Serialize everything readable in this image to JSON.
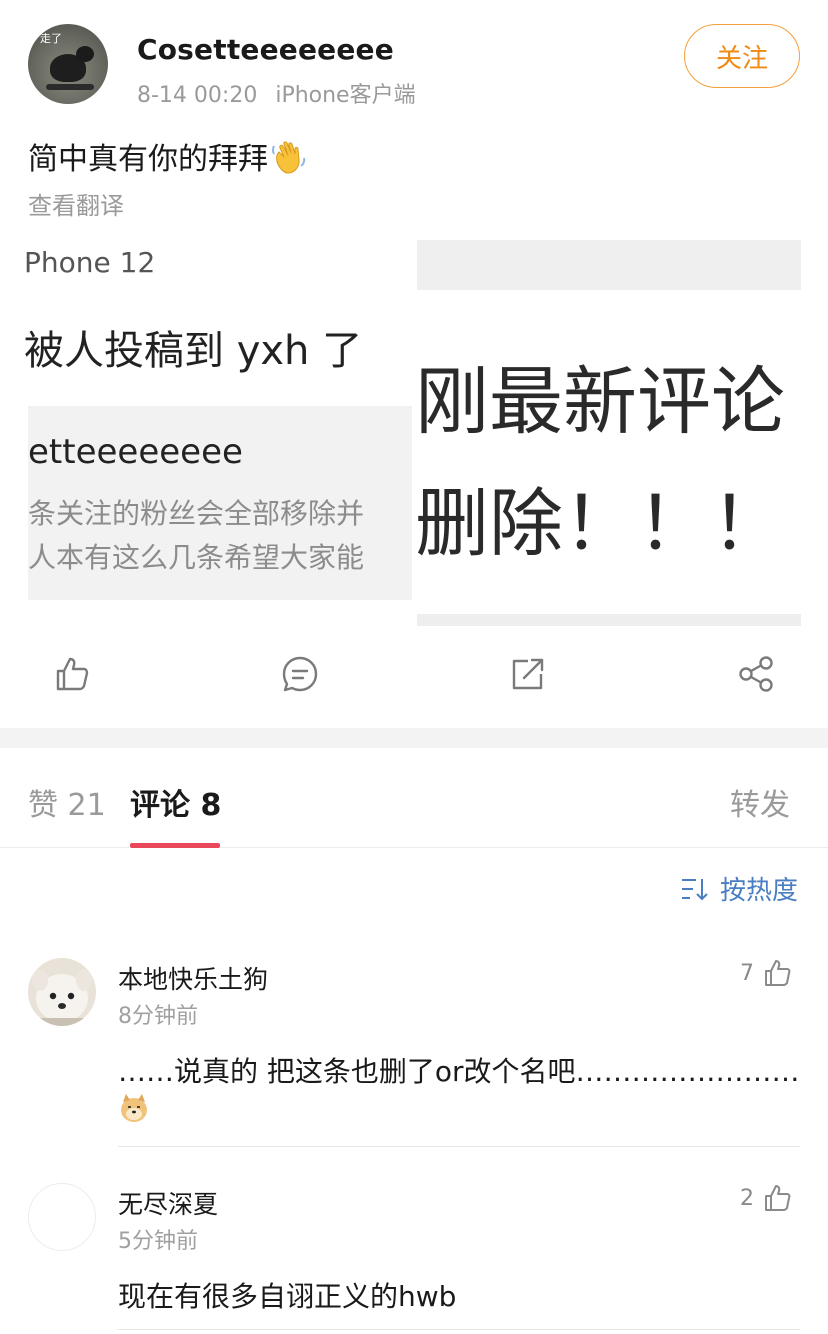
{
  "post": {
    "author": "Cosetteeeeeeee",
    "avatar_caption": "走了",
    "time": "8-14 00:20",
    "source": "iPhone客户端",
    "follow_label": "关注",
    "text": "简中真有你的拜拜",
    "text_emoji": "waving-hand-icon",
    "translate_label": "查看翻译"
  },
  "images": {
    "left": {
      "line1": "Phone 12",
      "line2": "被人投稿到 yxh 了",
      "line3": "etteeeeeeee",
      "line4": "条关注的粉丝会全部移除并",
      "line5": "人本有这么几条希望大家能"
    },
    "right": {
      "line1": "刚最新评论",
      "line2": "删除！！！"
    }
  },
  "actions": [
    "like-icon",
    "comment-icon",
    "repost-icon",
    "share-icon"
  ],
  "tabs": {
    "likes": "赞 21",
    "comments": "评论 8",
    "reposts": "转发"
  },
  "sort": {
    "label": "按热度",
    "icon": "sort-icon"
  },
  "comments": [
    {
      "user": "本地快乐土狗",
      "time": "8分钟前",
      "likes": "7",
      "text": "……说真的 把这条也删了or改个名吧……………………",
      "emoji": "doge-icon"
    },
    {
      "user": "无尽深夏",
      "time": "5分钟前",
      "likes": "2",
      "text": "现在有很多自诩正义的hwb"
    }
  ],
  "colors": {
    "accent_orange": "#f08a16",
    "tab_indicator": "#e8485a",
    "link_blue": "#4a7ec2"
  }
}
